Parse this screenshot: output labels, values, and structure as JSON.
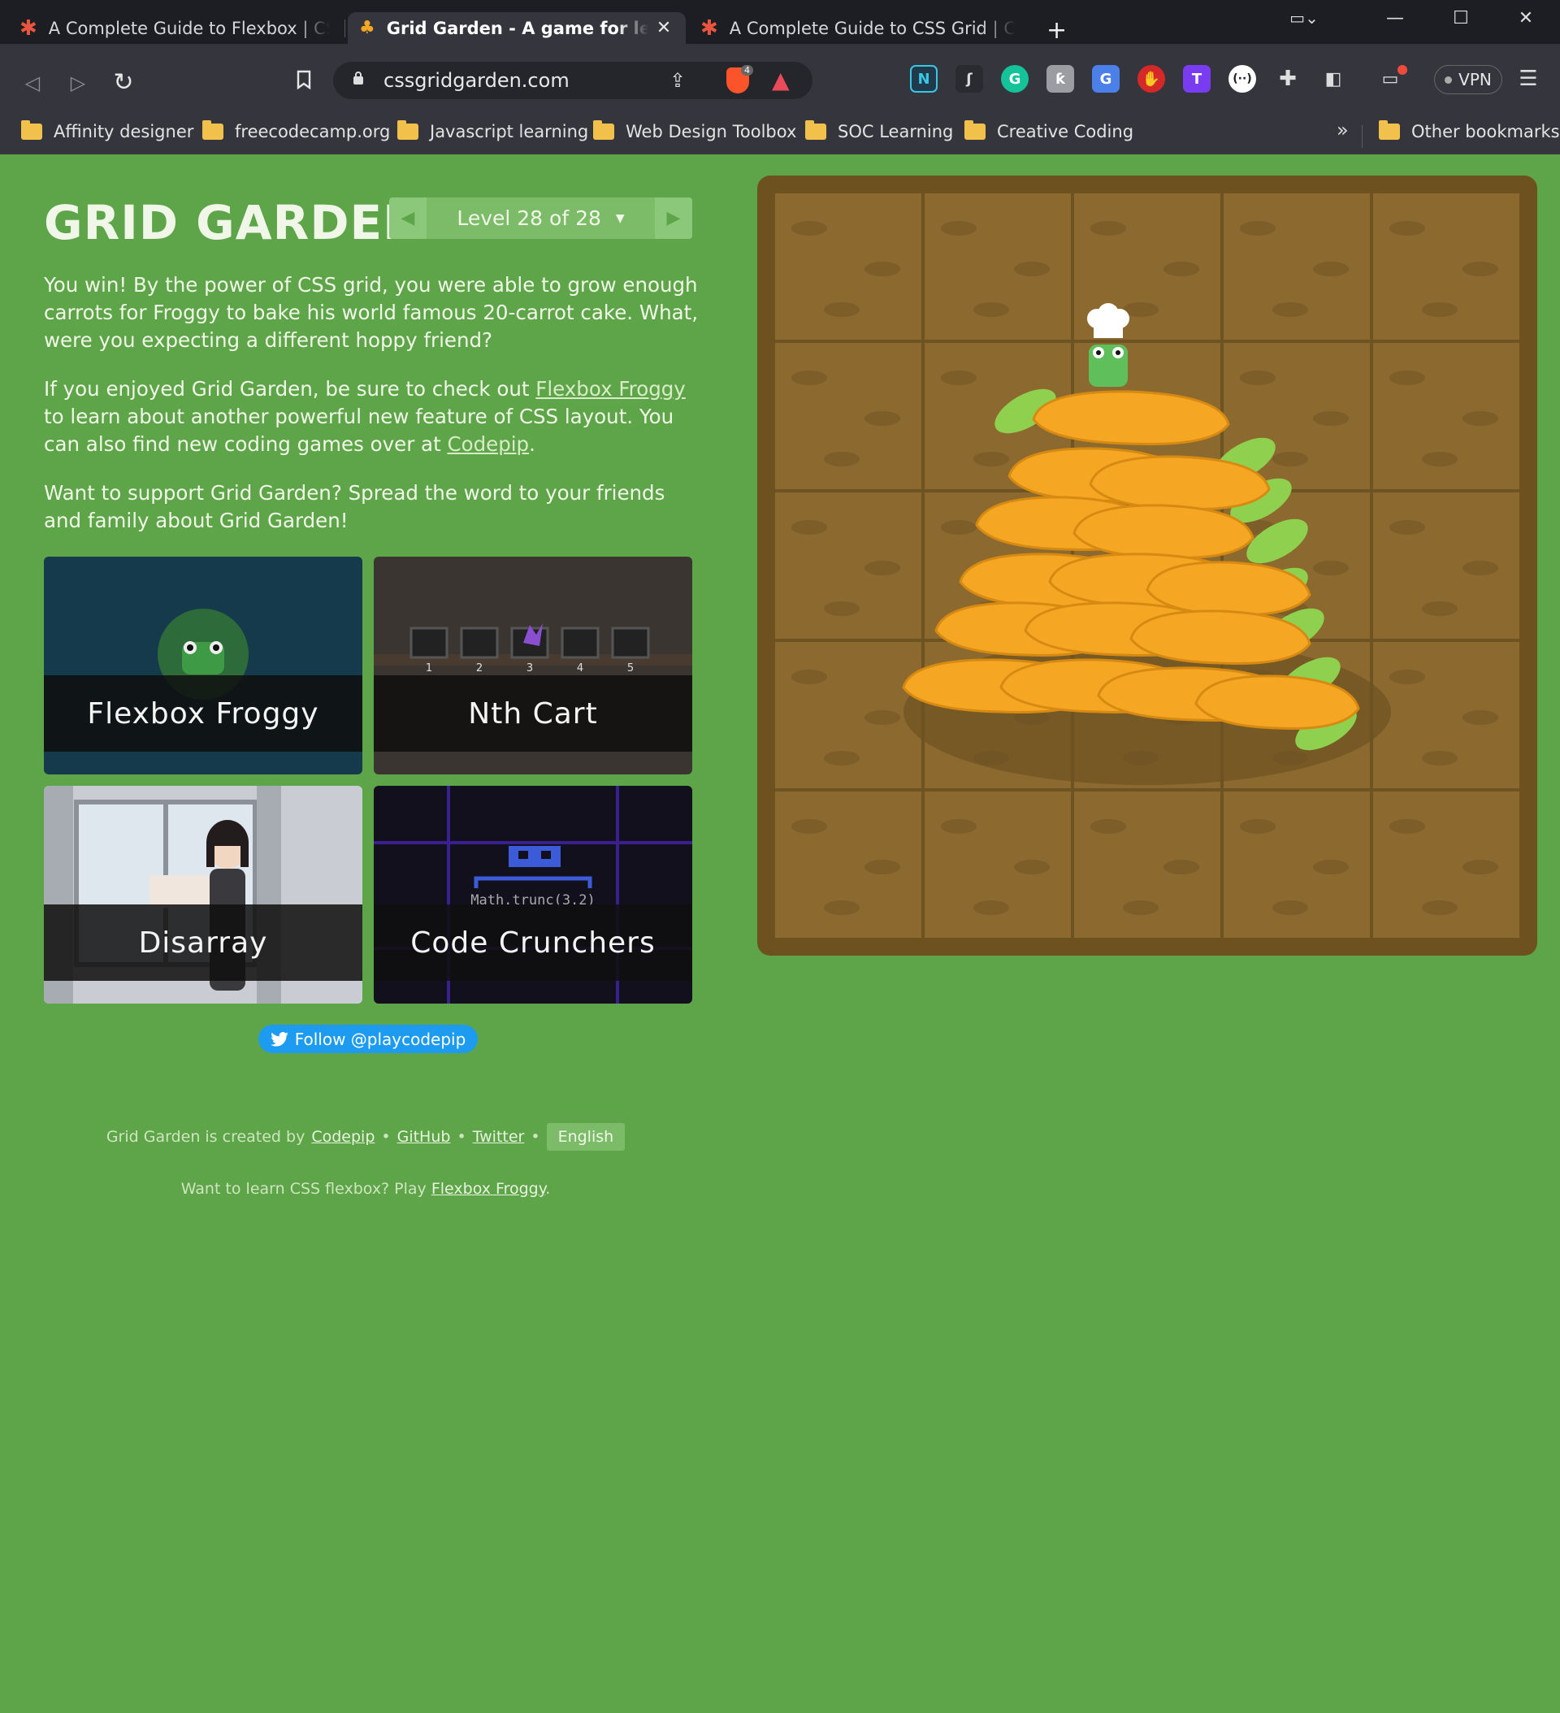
{
  "browser": {
    "tabs": [
      {
        "label": "A Complete Guide to Flexbox | CSS-Tricks",
        "active": false
      },
      {
        "label": "Grid Garden - A game for learning CSS grid",
        "active": true
      },
      {
        "label": "A Complete Guide to CSS Grid | CSS-Tricks",
        "active": false
      }
    ],
    "url": "cssgridgarden.com",
    "vpn_label": "VPN",
    "brave_badge": "4",
    "bookmarks": [
      "Affinity designer",
      "freecodecamp.org",
      "Javascript learning",
      "Web Design Toolbox",
      "SOC Learning",
      "Creative Coding"
    ],
    "bookmarks_more": "»",
    "other_bookmarks": "Other bookmarks"
  },
  "page": {
    "title": "GRID GARDEN",
    "level_label": "Level 28 of 28",
    "win_text": "You win! By the power of CSS grid, you were able to grow enough carrots for Froggy to bake his world famous 20-carrot cake. What, were you expecting a different hoppy friend?",
    "enjoy_prefix": "If you enjoyed Grid Garden, be sure to check out ",
    "enjoy_link1": "Flexbox Froggy",
    "enjoy_middle": " to learn about another powerful new feature of CSS layout. You can also find new coding games over at ",
    "enjoy_link2": "Codepip",
    "enjoy_suffix": ".",
    "support_text": "Want to support Grid Garden? Spread the word to your friends and family about Grid Garden!",
    "games": [
      {
        "title": "Flexbox Froggy",
        "bg": "#143a4c"
      },
      {
        "title": "Nth Cart",
        "bg": "#3a3530"
      },
      {
        "title": "Disarray",
        "bg": "#b9bcc3"
      },
      {
        "title": "Code Crunchers",
        "bg": "#12101c"
      }
    ],
    "nth_cart_numbers": [
      "1",
      "2",
      "3",
      "4",
      "5"
    ],
    "code_crunchers_code": "Math.trunc(3.2)",
    "follow_label": "Follow @playcodepip",
    "footer": {
      "created_by": "Grid Garden is created by",
      "codepip": "Codepip",
      "github": "GitHub",
      "twitter": "Twitter",
      "bullet": "•",
      "language": "English",
      "flexbox_prefix": "Want to learn CSS flexbox? Play ",
      "flexbox_link": "Flexbox Froggy",
      "flexbox_suffix": "."
    }
  },
  "colors": {
    "page_bg": "#5da548",
    "garden_border": "#6d5220",
    "soil": "#8c6a2f",
    "carrot": "#f5a623",
    "leaf": "#8fd14f"
  }
}
